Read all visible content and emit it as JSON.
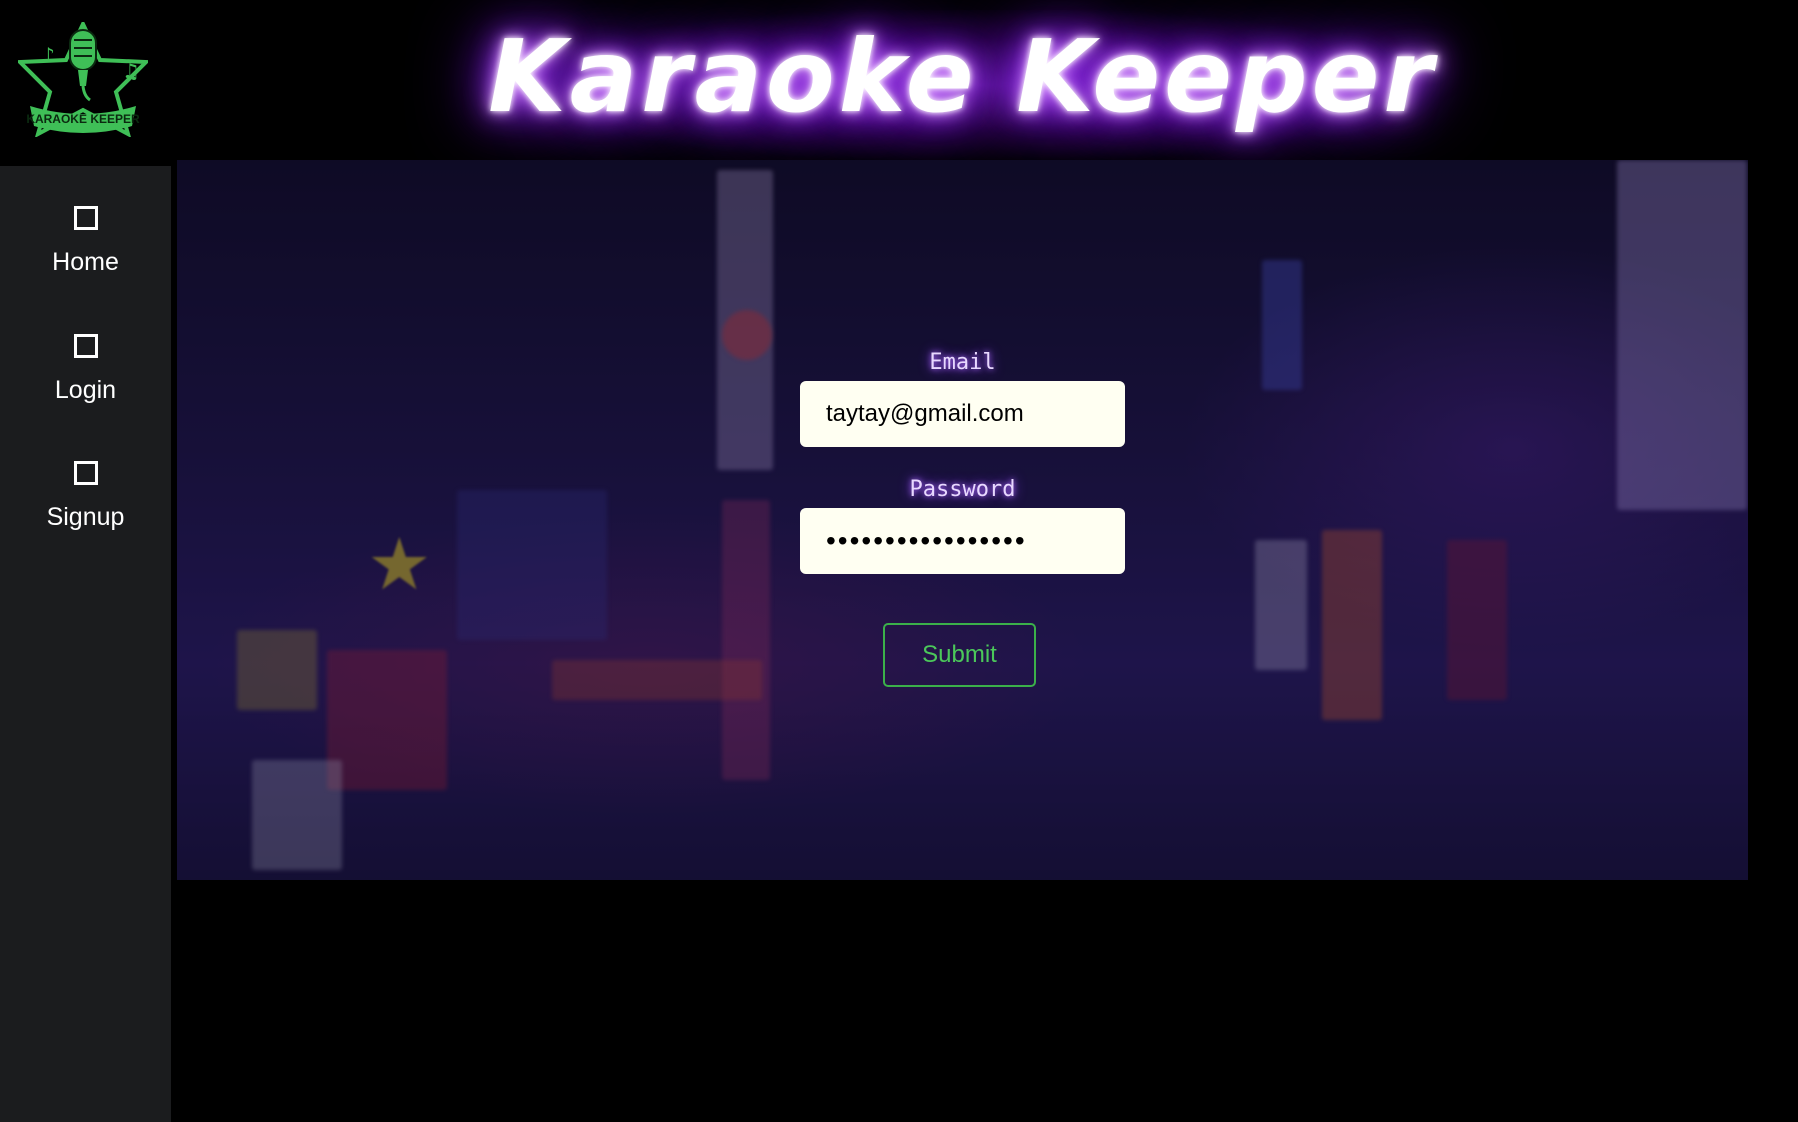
{
  "header": {
    "title": "Karaoke Keeper",
    "logo_text": "KARAOKE KEEPER",
    "logo_icon": "microphone-icon",
    "brand_color": "#3fbf57"
  },
  "sidebar": {
    "items": [
      {
        "label": "Home",
        "icon": "square-icon"
      },
      {
        "label": "Login",
        "icon": "square-icon"
      },
      {
        "label": "Signup",
        "icon": "square-icon"
      }
    ]
  },
  "form": {
    "email_label": "Email",
    "email_value": "taytay@gmail.com",
    "password_label": "Password",
    "password_value": "•••••••••••••••••",
    "submit_label": "Submit",
    "accent_color": "#3bb04a"
  }
}
